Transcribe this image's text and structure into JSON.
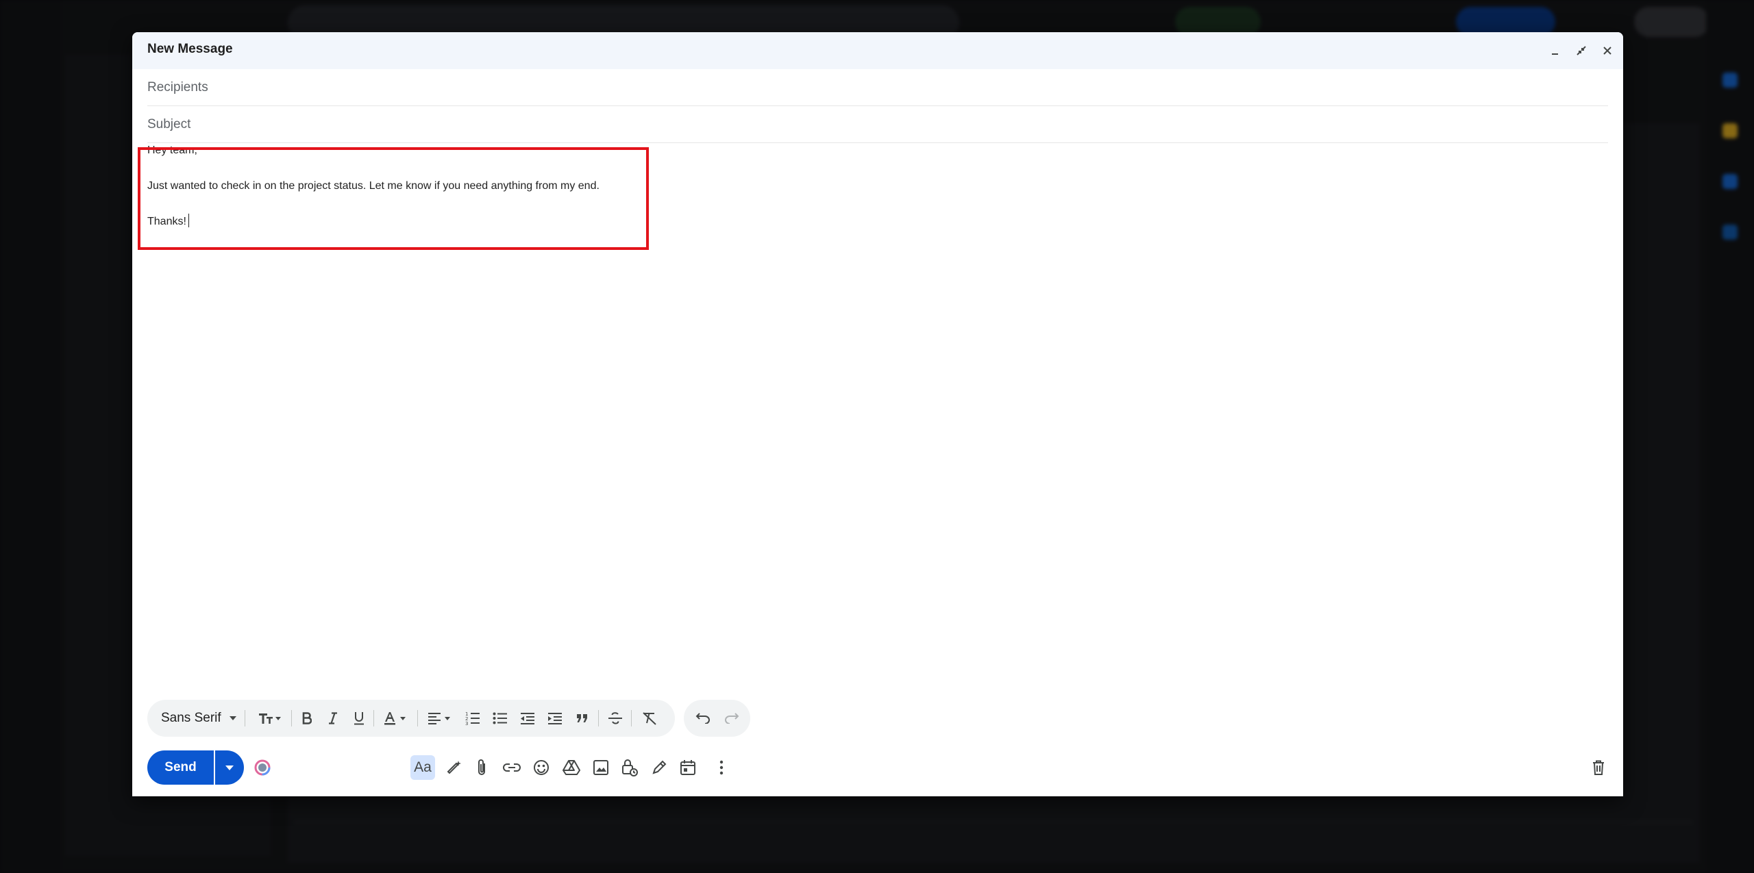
{
  "compose": {
    "title": "New Message",
    "recipients_placeholder": "Recipients",
    "subject_placeholder": "Subject",
    "body": {
      "greeting": "Hey team,",
      "paragraph": "Just wanted to check in on the project status. Let me know if you need anything from my end.",
      "signoff": "Thanks!"
    },
    "font_family_label": "Sans Serif",
    "send_label": "Send"
  },
  "icons": {
    "header": [
      "minimize-icon",
      "exit-fullscreen-icon",
      "close-icon"
    ],
    "formatting": [
      "text-size-icon",
      "bold-icon",
      "italic-icon",
      "underline-icon",
      "text-color-icon",
      "align-icon",
      "numbered-list-icon",
      "bulleted-list-icon",
      "indent-less-icon",
      "indent-more-icon",
      "quote-icon",
      "strikethrough-icon",
      "remove-formatting-icon",
      "undo-icon",
      "redo-icon"
    ],
    "actions": [
      "layouts-icon",
      "formatting-options-icon",
      "help-me-write-icon",
      "attach-icon",
      "link-icon",
      "emoji-icon",
      "drive-icon",
      "photo-icon",
      "confidential-icon",
      "signature-icon",
      "schedule-icon",
      "more-options-icon",
      "discard-icon"
    ]
  },
  "colors": {
    "send_blue": "#0b57d0",
    "header_bg": "#f2f6fc",
    "highlight_red": "#e3141b"
  }
}
